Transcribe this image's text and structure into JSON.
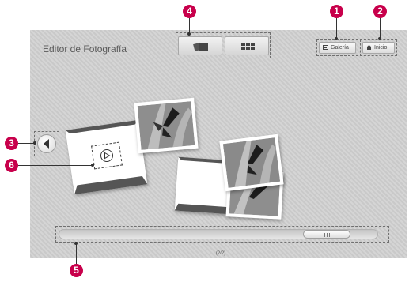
{
  "app": {
    "title": "Editor de Fotografía"
  },
  "toolbar": {
    "view_buttons": [
      {
        "name": "view-stack",
        "icon": "stacked-photos-icon"
      },
      {
        "name": "view-grid",
        "icon": "grid-icon"
      }
    ],
    "gallery_label": "Galería",
    "gallery_icon": "gallery-icon",
    "home_label": "Inicio",
    "home_icon": "home-icon"
  },
  "navigation": {
    "back_icon": "left-arrow-icon"
  },
  "frame": {
    "play_icon": "play-icon"
  },
  "scrollbar": {
    "position": 0.9
  },
  "pager": {
    "text": "(2/2)"
  },
  "callouts": [
    "1",
    "2",
    "3",
    "4",
    "5",
    "6"
  ],
  "colors": {
    "callout": "#c8004b",
    "screen": "#cfcfcf"
  }
}
